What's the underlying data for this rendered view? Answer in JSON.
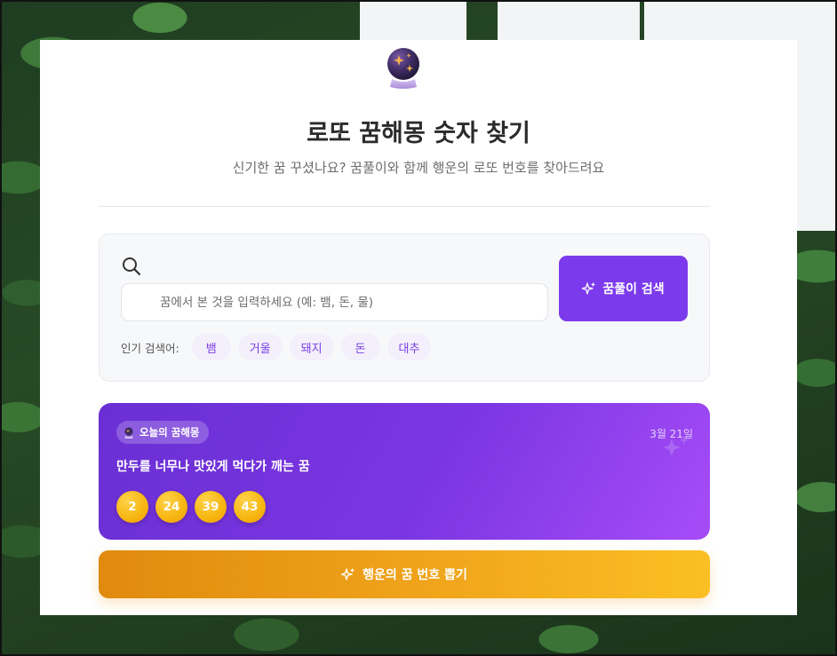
{
  "header": {
    "title": "로또 꿈해몽 숫자 찾기",
    "subtitle": "신기한 꿈 꾸셨나요? 꿈풀이와 함께 행운의 로또 번호를 찾아드려요"
  },
  "search": {
    "placeholder": "꿈에서 본 것을 입력하세요 (예: 뱀, 돈, 물)",
    "value": "",
    "button_label": "꿈풀이 검색",
    "popular_label": "인기 검색어:",
    "popular_terms": [
      "뱀",
      "거울",
      "돼지",
      "돈",
      "대추"
    ]
  },
  "today": {
    "badge_label": "오늘의 꿈해몽",
    "date": "3월 21일",
    "dream": "만두를 너무나 맛있게 먹다가 깨는 꿈",
    "numbers": [
      "2",
      "24",
      "39",
      "43"
    ]
  },
  "lucky_button_label": "행운의 꿈 번호 뽑기",
  "colors": {
    "accent": "#7c3aed",
    "gold": "#f6b50f",
    "chip_bg": "#f3effb"
  },
  "icons": {
    "logo": "crystal-ball-icon",
    "search": "search-icon",
    "sparkle": "sparkles-icon"
  }
}
